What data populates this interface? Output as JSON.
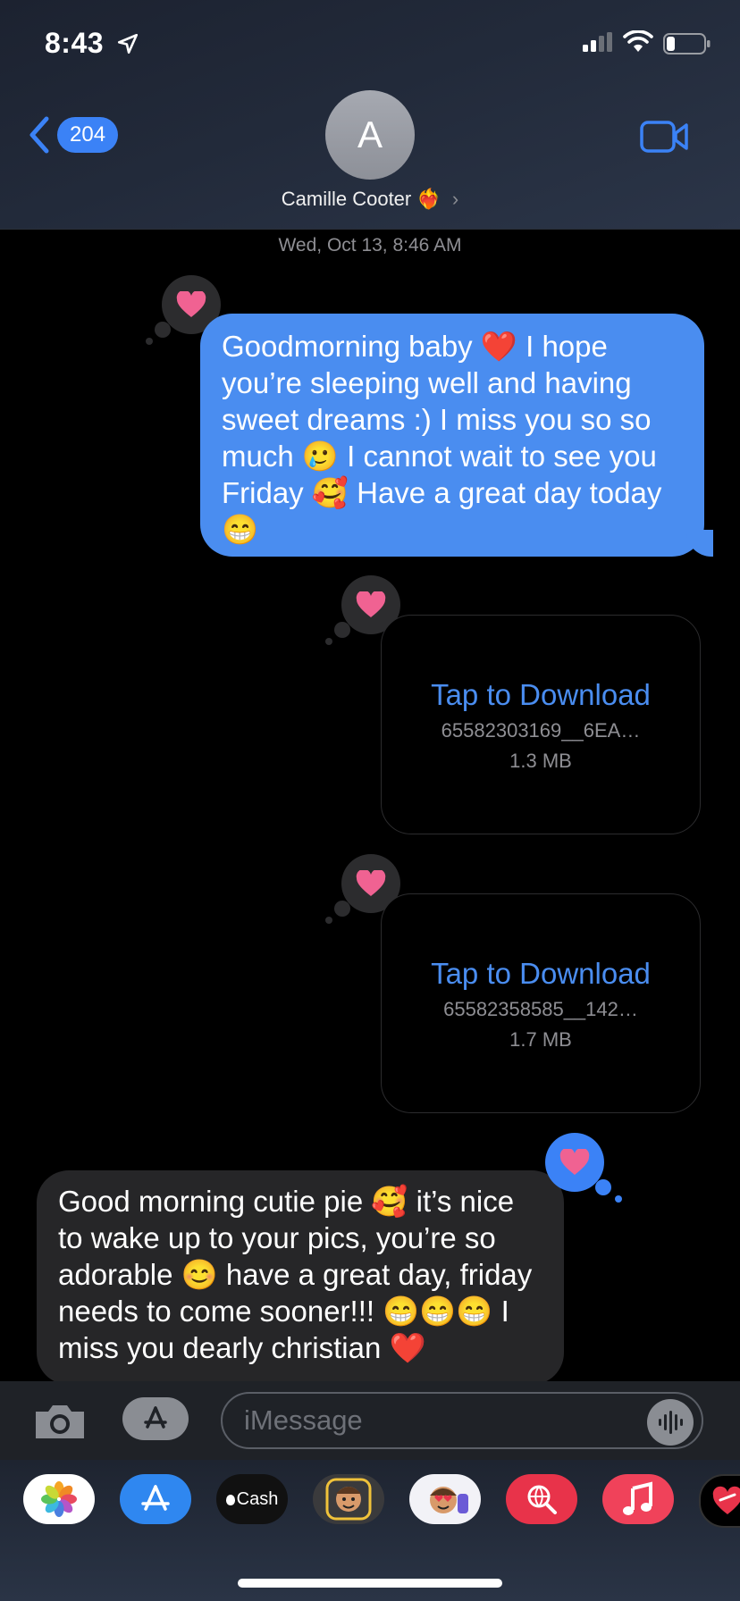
{
  "status": {
    "time": "8:43"
  },
  "header": {
    "back_count": "204",
    "avatar_initial": "A",
    "contact_name": "Camille Cooter",
    "contact_emoji": "❤️‍🔥",
    "chevron": "›"
  },
  "thread": {
    "date": "Wed, Oct 13, 8:46 AM",
    "messages": [
      {
        "text": "Goodmorning baby ❤️ I hope you’re sleeping well and having sweet dreams :) I miss you so so much 🥲 I cannot wait to see you Friday 🥰 Have a great day today 😁"
      },
      {
        "tap_label": "Tap to Download",
        "file_name": "65582303169__6EA…",
        "file_size": "1.3 MB"
      },
      {
        "tap_label": "Tap to Download",
        "file_name": "65582358585__142…",
        "file_size": "1.7 MB"
      },
      {
        "text": "Good morning cutie pie 🥰 it’s nice to wake up to your pics, you’re so adorable 😊 have a great day, friday needs to come sooner!!! 😁😁😁 I miss you dearly christian ❤️"
      }
    ]
  },
  "compose": {
    "placeholder": "iMessage"
  },
  "apps": {
    "cash_label": "Cash",
    "items": [
      "photos-icon",
      "app-store-icon",
      "apple-cash-icon",
      "memoji-icon",
      "memoji-stickers-icon",
      "web-images-icon",
      "music-icon",
      "digital-touch-icon"
    ]
  },
  "colors": {
    "accent": "#4a8df0",
    "tapback_heart": "#f06292"
  }
}
